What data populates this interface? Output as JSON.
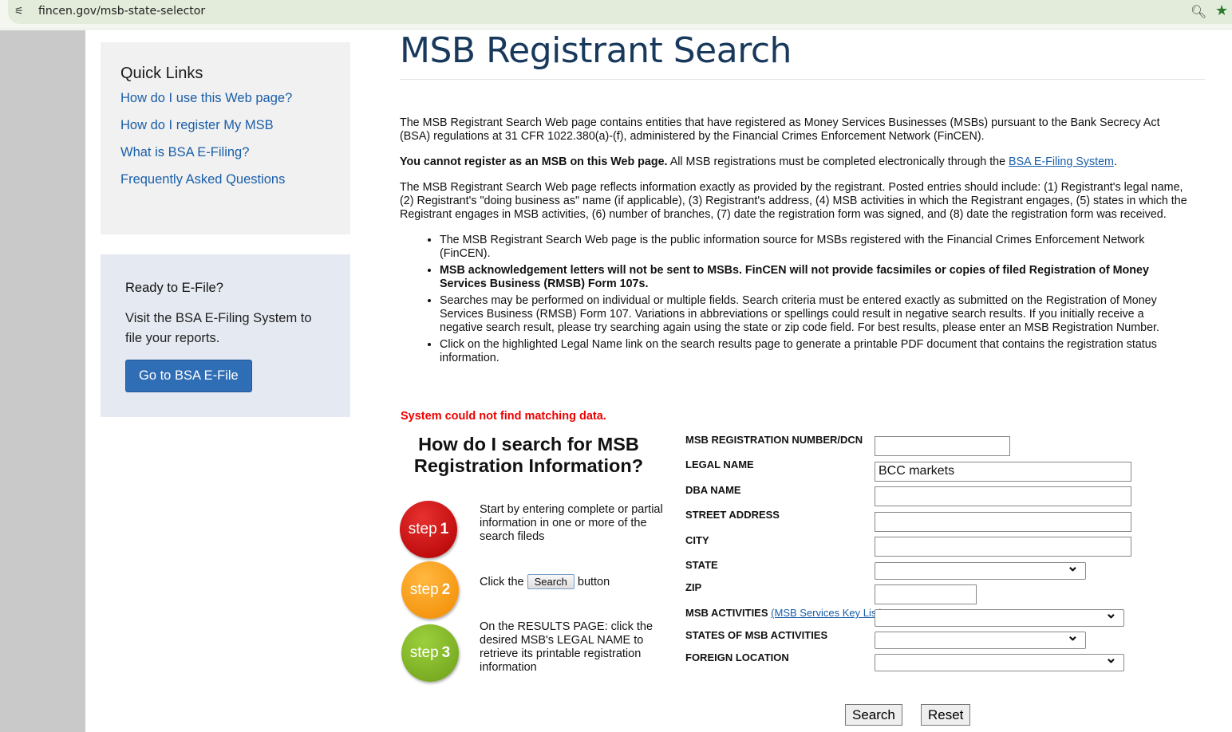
{
  "browser": {
    "url": "fincen.gov/msb-state-selector"
  },
  "sidebar": {
    "quick_links_title": "Quick Links",
    "links": [
      "How do I use this Web page?",
      "How do I register My MSB",
      "What is BSA E-Filing?",
      "Frequently Asked Questions"
    ],
    "efile_title": "Ready to E-File?",
    "efile_text": "Visit the BSA E-Filing System to file your reports.",
    "efile_button": "Go to BSA E-File"
  },
  "main": {
    "title": "MSB Registrant Search",
    "intro": "The MSB Registrant Search Web page contains entities that have registered as Money Services Businesses (MSBs) pursuant to the Bank Secrecy Act (BSA) regulations at 31 CFR 1022.380(a)-(f), administered by the Financial Crimes Enforcement Network (FinCEN).",
    "warning_bold": "You cannot register as an MSB on this Web page.",
    "warning_rest": " All MSB registrations must be completed electronically through the ",
    "warning_link": "BSA E-Filing System",
    "warning_end": ".",
    "details": "The MSB Registrant Search Web page reflects information exactly as provided by the registrant. Posted entries should include: (1) Registrant's legal name, (2) Registrant's \"doing business as\" name (if applicable), (3) Registrant's address, (4) MSB activities in which the Registrant engages, (5) states in which the Registrant engages in MSB activities, (6) number of branches, (7) date the registration form was signed, and (8) date the registration form was received.",
    "bullets": [
      "The MSB Registrant Search Web page is the public information source for MSBs registered with the Financial Crimes Enforcement Network (FinCEN).",
      "MSB acknowledgement letters will not be sent to MSBs. FinCEN will not provide facsimiles or copies of filed Registration of Money Services Business (RMSB) Form 107s.",
      "Searches may be performed on individual or multiple fields. Search criteria must be entered exactly as submitted on the Registration of Money Services Business (RMSB) Form 107. Variations in abbreviations or spellings could result in negative search results. If you initially receive a negative search result, please try searching again using the state or zip code field. For best results, please enter an MSB Registration Number.",
      "Click on the highlighted Legal Name link on the search results page to generate a printable PDF document that contains the registration status information."
    ],
    "error": "System could not find matching data.",
    "how_title": "How do I search for MSB Registration Information?",
    "steps": [
      {
        "badge_word": "step",
        "badge_num": "1",
        "color": "#cc1111",
        "text": "Start by entering complete or partial information in one or more of the search fileds"
      },
      {
        "badge_word": "step",
        "badge_num": "2",
        "color": "#f59a10",
        "text_before": "Click the",
        "inline_button": "Search",
        "text_after": "button"
      },
      {
        "badge_word": "step",
        "badge_num": "3",
        "color": "#7ab021",
        "text": "On the RESULTS PAGE: click the desired MSB's LEGAL NAME to retrieve its printable registration information"
      }
    ]
  },
  "form": {
    "labels": {
      "reg": "MSB REGISTRATION NUMBER/DCN",
      "legal": "LEGAL NAME",
      "dba": "DBA NAME",
      "street": "STREET ADDRESS",
      "city": "CITY",
      "state": "STATE",
      "zip": "ZIP",
      "activities": "MSB ACTIVITIES",
      "activities_link": "(MSB Services Key List)",
      "states_act": "STATES OF MSB ACTIVITIES",
      "foreign": "FOREIGN LOCATION"
    },
    "values": {
      "legal": "BCC markets"
    },
    "search_button": "Search",
    "reset_button": "Reset"
  }
}
